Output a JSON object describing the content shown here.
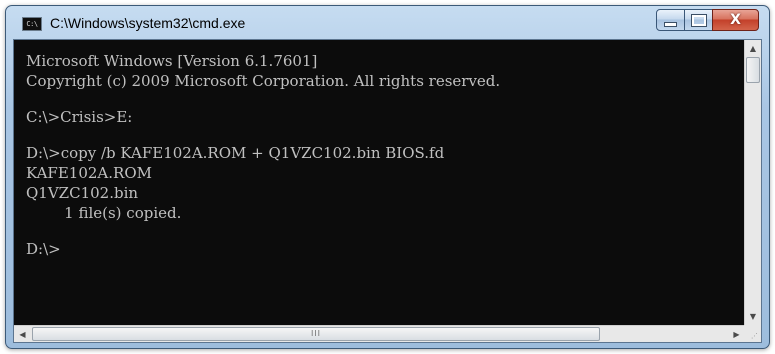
{
  "window": {
    "title": "C:\\Windows\\system32\\cmd.exe",
    "icon": "console-icon",
    "icon_text": "C:\\",
    "caption": {
      "minimize_icon": "minimize-icon",
      "maximize_icon": "maximize-icon",
      "close_icon": "close-icon",
      "close_glyph": "X"
    }
  },
  "console": {
    "lines": [
      "Microsoft Windows [Version 6.1.7601]",
      "Copyright (c) 2009 Microsoft Corporation. All rights reserved.",
      "",
      "C:\\>Crisis>E:",
      "",
      "D:\\>copy /b KAFE102A.ROM + Q1VZC102.bin BIOS.fd",
      "KAFE102A.ROM",
      "Q1VZC102.bin",
      "        1 file(s) copied.",
      "",
      "D:\\>"
    ]
  },
  "scrollbars": {
    "vertical": {
      "up_glyph": "▲",
      "down_glyph": "▼",
      "position": 0
    },
    "horizontal": {
      "left_glyph": "◀",
      "right_glyph": "▶",
      "grip": "III",
      "position": 0
    }
  },
  "colors": {
    "console_bg": "#0c0c0c",
    "console_text": "#c0c0c0",
    "titlebar": "#a9c6e4",
    "close_button": "#c3402a"
  }
}
